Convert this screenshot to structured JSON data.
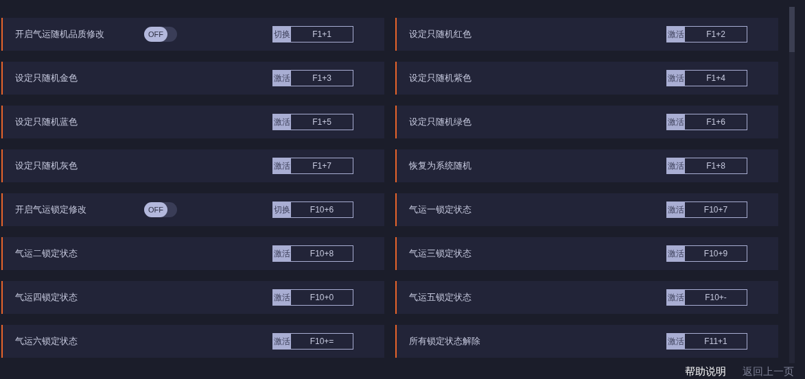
{
  "options": [
    {
      "label": "开启气运随机品质修改",
      "kind": "toggle",
      "on": false,
      "toggle_text": "OFF",
      "action": "切换",
      "key": "F1+1"
    },
    {
      "label": "设定只随机红色",
      "kind": "plain",
      "action": "激活",
      "key": "F1+2"
    },
    {
      "label": "设定只随机金色",
      "kind": "plain",
      "action": "激活",
      "key": "F1+3"
    },
    {
      "label": "设定只随机紫色",
      "kind": "plain",
      "action": "激活",
      "key": "F1+4"
    },
    {
      "label": "设定只随机蓝色",
      "kind": "plain",
      "action": "激活",
      "key": "F1+5"
    },
    {
      "label": "设定只随机绿色",
      "kind": "plain",
      "action": "激活",
      "key": "F1+6"
    },
    {
      "label": "设定只随机灰色",
      "kind": "plain",
      "action": "激活",
      "key": "F1+7"
    },
    {
      "label": "恢复为系统随机",
      "kind": "plain",
      "action": "激活",
      "key": "F1+8"
    },
    {
      "label": "开启气运锁定修改",
      "kind": "toggle",
      "on": false,
      "toggle_text": "OFF",
      "action": "切换",
      "key": "F10+6"
    },
    {
      "label": "气运一锁定状态",
      "kind": "plain",
      "action": "激活",
      "key": "F10+7"
    },
    {
      "label": "气运二锁定状态",
      "kind": "plain",
      "action": "激活",
      "key": "F10+8"
    },
    {
      "label": "气运三锁定状态",
      "kind": "plain",
      "action": "激活",
      "key": "F10+9"
    },
    {
      "label": "气运四锁定状态",
      "kind": "plain",
      "action": "激活",
      "key": "F10+0"
    },
    {
      "label": "气运五锁定状态",
      "kind": "plain",
      "action": "激活",
      "key": "F10+-"
    },
    {
      "label": "气运六锁定状态",
      "kind": "plain",
      "action": "激活",
      "key": "F10+="
    },
    {
      "label": "所有锁定状态解除",
      "kind": "plain",
      "action": "激活",
      "key": "F11+1"
    }
  ],
  "footer": {
    "help": "帮助说明",
    "back": "返回上一页"
  }
}
